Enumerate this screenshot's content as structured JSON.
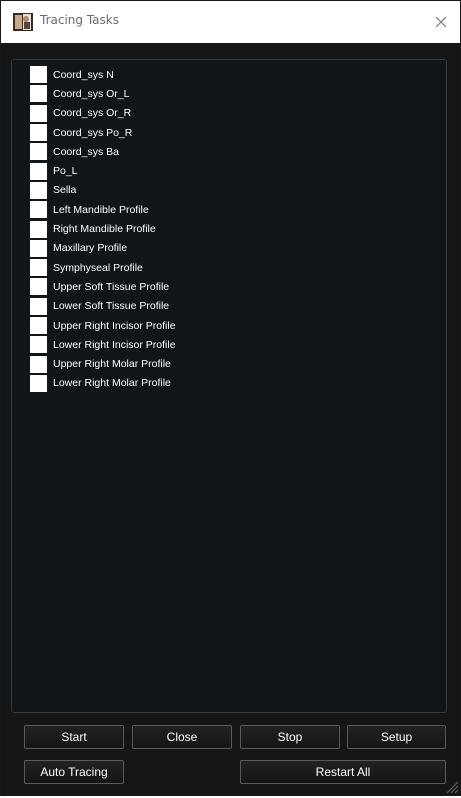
{
  "window": {
    "title": "Tracing Tasks"
  },
  "icons": {
    "app": "app-photo-icon",
    "close": "close-icon",
    "grip": "resize-grip-icon"
  },
  "tasks": [
    {
      "label": "Coord_sys N",
      "checked": false
    },
    {
      "label": "Coord_sys Or_L",
      "checked": false
    },
    {
      "label": "Coord_sys Or_R",
      "checked": false
    },
    {
      "label": "Coord_sys Po_R",
      "checked": false
    },
    {
      "label": "Coord_sys Ba",
      "checked": false
    },
    {
      "label": "Po_L",
      "checked": false
    },
    {
      "label": "Sella",
      "checked": false
    },
    {
      "label": "Left Mandible Profile",
      "checked": false
    },
    {
      "label": "Right Mandible Profile",
      "checked": false
    },
    {
      "label": "Maxillary Profile",
      "checked": false
    },
    {
      "label": "Symphyseal Profile",
      "checked": false
    },
    {
      "label": "Upper Soft Tissue Profile",
      "checked": false
    },
    {
      "label": "Lower Soft Tissue Profile",
      "checked": false
    },
    {
      "label": "Upper Right Incisor Profile",
      "checked": false
    },
    {
      "label": "Lower Right Incisor Profile",
      "checked": false
    },
    {
      "label": "Upper Right Molar Profile",
      "checked": false
    },
    {
      "label": "Lower Right Molar Profile",
      "checked": false
    }
  ],
  "buttons": {
    "start": "Start",
    "close": "Close",
    "stop": "Stop",
    "setup": "Setup",
    "auto_tracing": "Auto Tracing",
    "restart_all": "Restart All"
  },
  "colors": {
    "background": "#151515",
    "panel": "#0f1519",
    "text": "#ffffff",
    "checkbox": "#ffffff"
  }
}
